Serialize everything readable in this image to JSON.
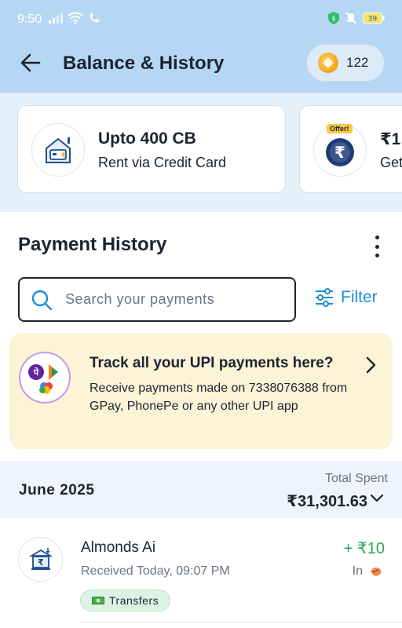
{
  "status_bar": {
    "time": "9:50",
    "battery": "39"
  },
  "header": {
    "title": "Balance & History",
    "coins": "122"
  },
  "offers": [
    {
      "title": "Upto 400 CB",
      "subtitle": "Rent via Credit Card",
      "icon": "house-card-icon"
    },
    {
      "title": "₹1",
      "subtitle": "Get",
      "tag": "Offer!",
      "icon": "rupee-offer-icon"
    }
  ],
  "payment_history": {
    "title": "Payment History",
    "search_placeholder": "Search your payments",
    "filter_label": "Filter"
  },
  "upi_banner": {
    "title": "Track all your UPI payments here?",
    "text": "Receive payments made on 7338076388 from GPay, PhonePe or any other UPI app"
  },
  "month": {
    "label": "June 2025",
    "total_label": "Total Spent",
    "total_amount": "₹31,301.63"
  },
  "transactions": [
    {
      "name": "Almonds Ai",
      "meta": "Received Today, 09:07 PM",
      "amount": "+ ₹10",
      "direction": "In",
      "category": "Transfers"
    }
  ],
  "colors": {
    "header_bg": "#b6d7f3",
    "accent_blue": "#1a8fd6",
    "credit_green": "#2aa55b",
    "banner_bg": "#fdf3d7"
  }
}
